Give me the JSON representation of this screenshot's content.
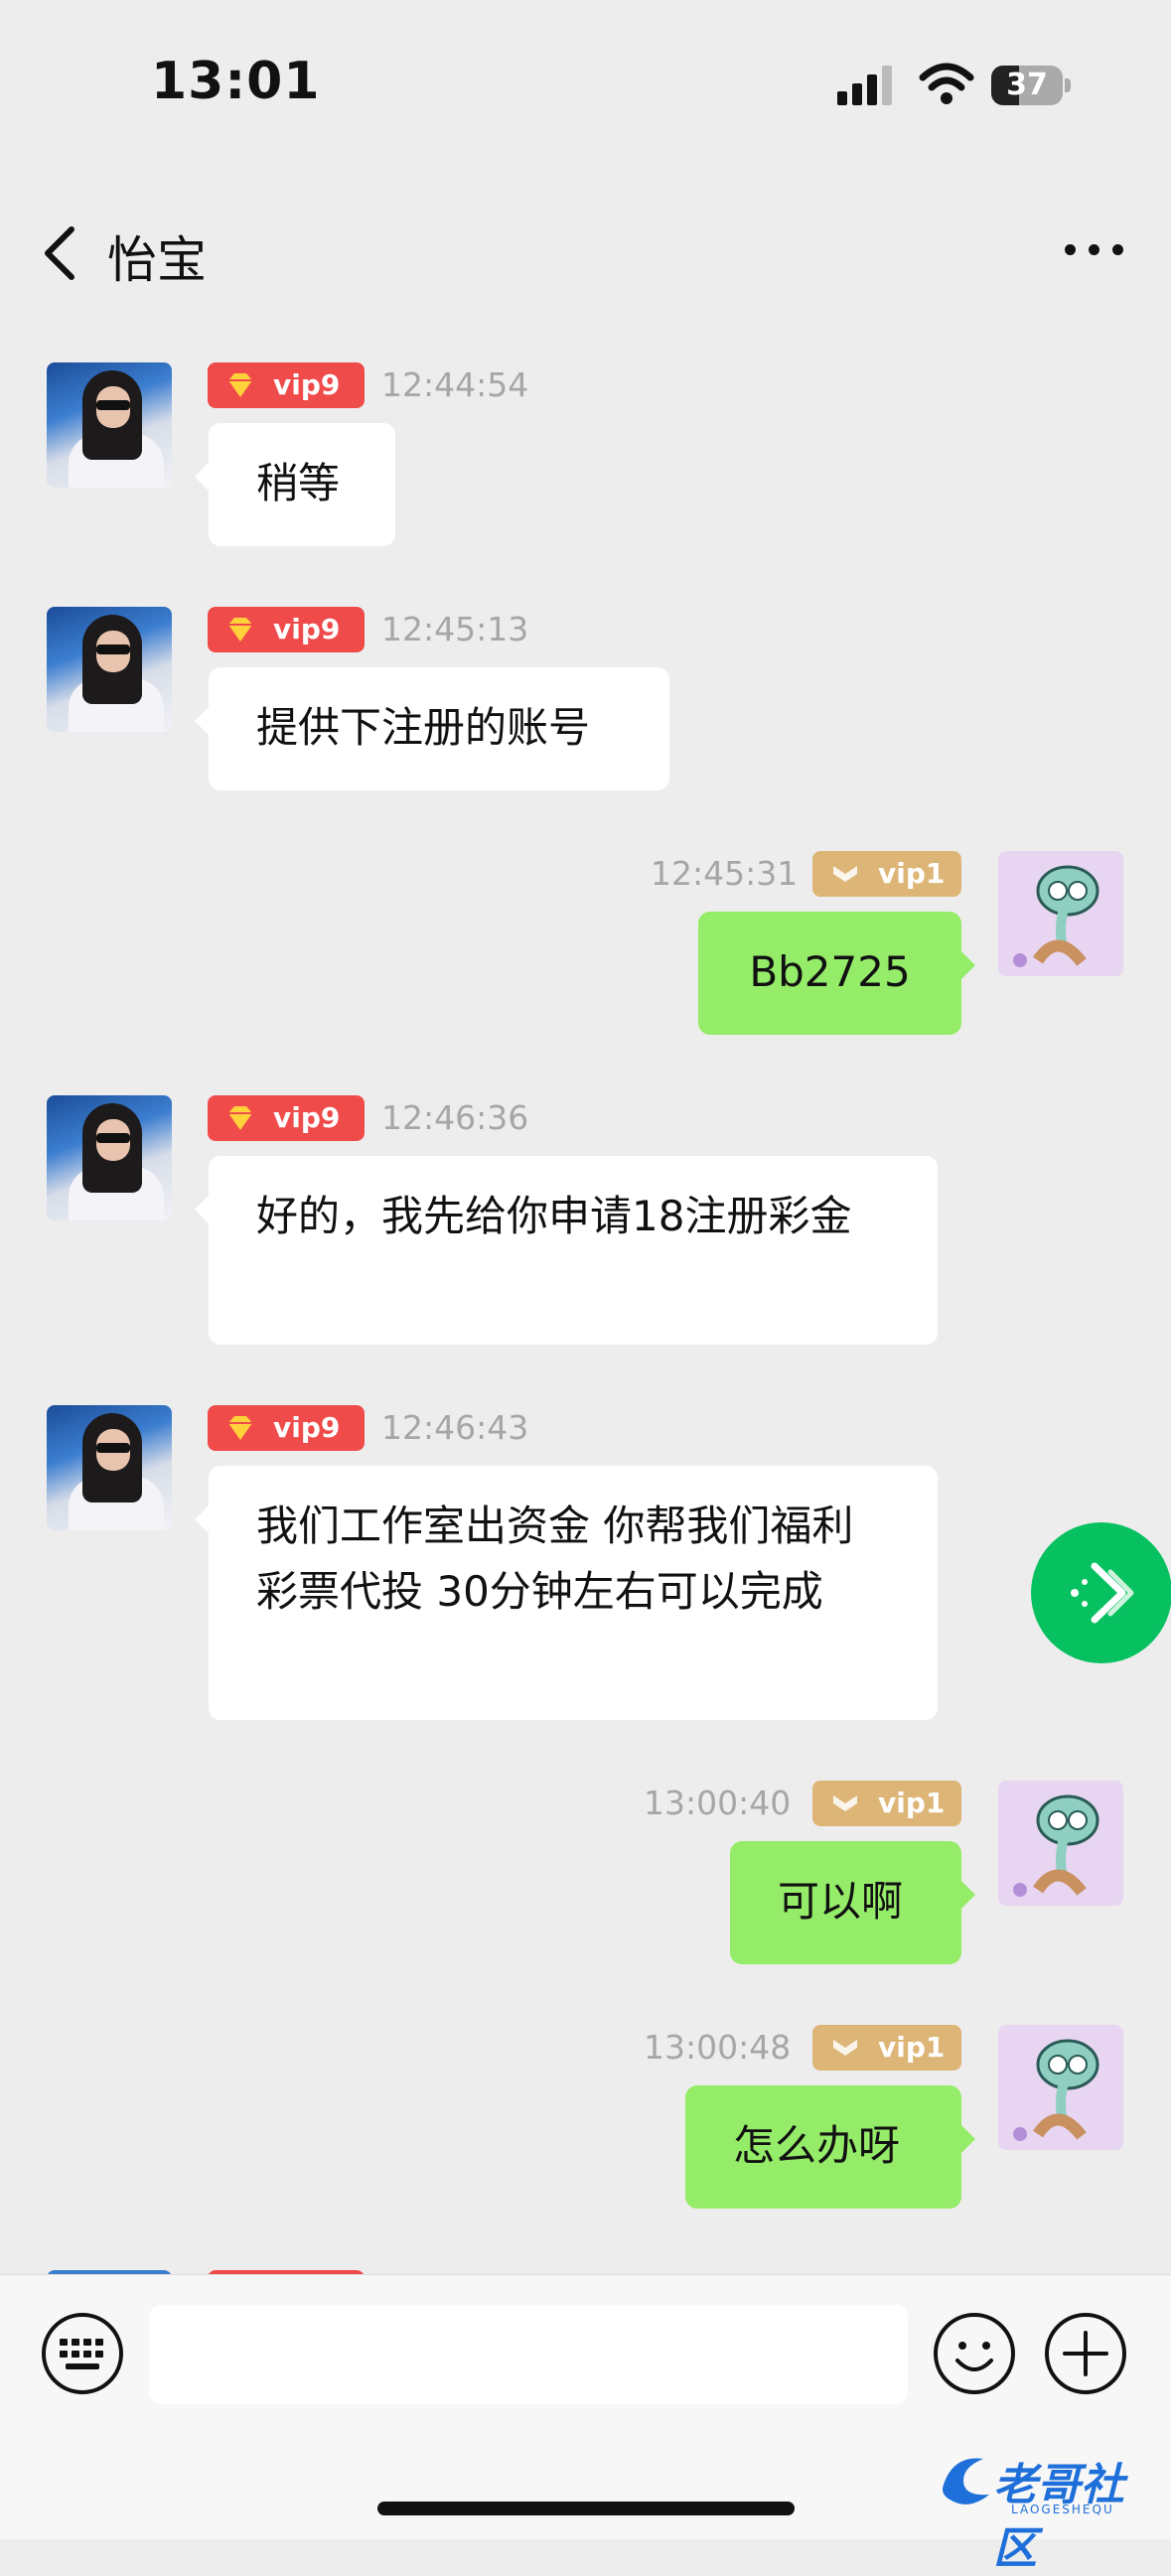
{
  "status_bar": {
    "time": "13:01",
    "battery": "37"
  },
  "nav": {
    "title": "怡宝"
  },
  "messages": [
    {
      "side": "in",
      "badge": "vip9",
      "time": "12:44:54",
      "text": "稍等"
    },
    {
      "side": "in",
      "badge": "vip9",
      "time": "12:45:13",
      "text": "提供下注册的账号"
    },
    {
      "side": "out",
      "badge": "vip1",
      "time": "12:45:31",
      "text": "Bb2725"
    },
    {
      "side": "in",
      "badge": "vip9",
      "time": "12:46:36",
      "text": "好的，我先给你申请18注册彩金"
    },
    {
      "side": "in",
      "badge": "vip9",
      "time": "12:46:43",
      "text": "我们工作室出资金 你帮我们福利彩票代投 30分钟左右可以完成"
    },
    {
      "side": "out",
      "badge": "vip1",
      "time": "13:00:40",
      "text": "可以啊"
    },
    {
      "side": "out",
      "badge": "vip1",
      "time": "13:00:48",
      "text": "怎么办呀"
    }
  ],
  "input": {
    "value": ""
  },
  "watermark": {
    "text": "老哥社区",
    "sub": "LAOGESHEQU"
  },
  "colors": {
    "background": "#ededed",
    "bubble_in": "#ffffff",
    "bubble_out": "#95ec69",
    "vip9": "#f04b4b",
    "vip1": "#ddb677",
    "accent_green": "#07c160"
  },
  "icons": [
    "back-chevron-icon",
    "more-icon",
    "gem-icon",
    "chevron-badge-icon",
    "forward-icon",
    "keyboard-icon",
    "emoji-icon",
    "plus-icon",
    "signal-icon",
    "wifi-icon",
    "battery-icon"
  ]
}
